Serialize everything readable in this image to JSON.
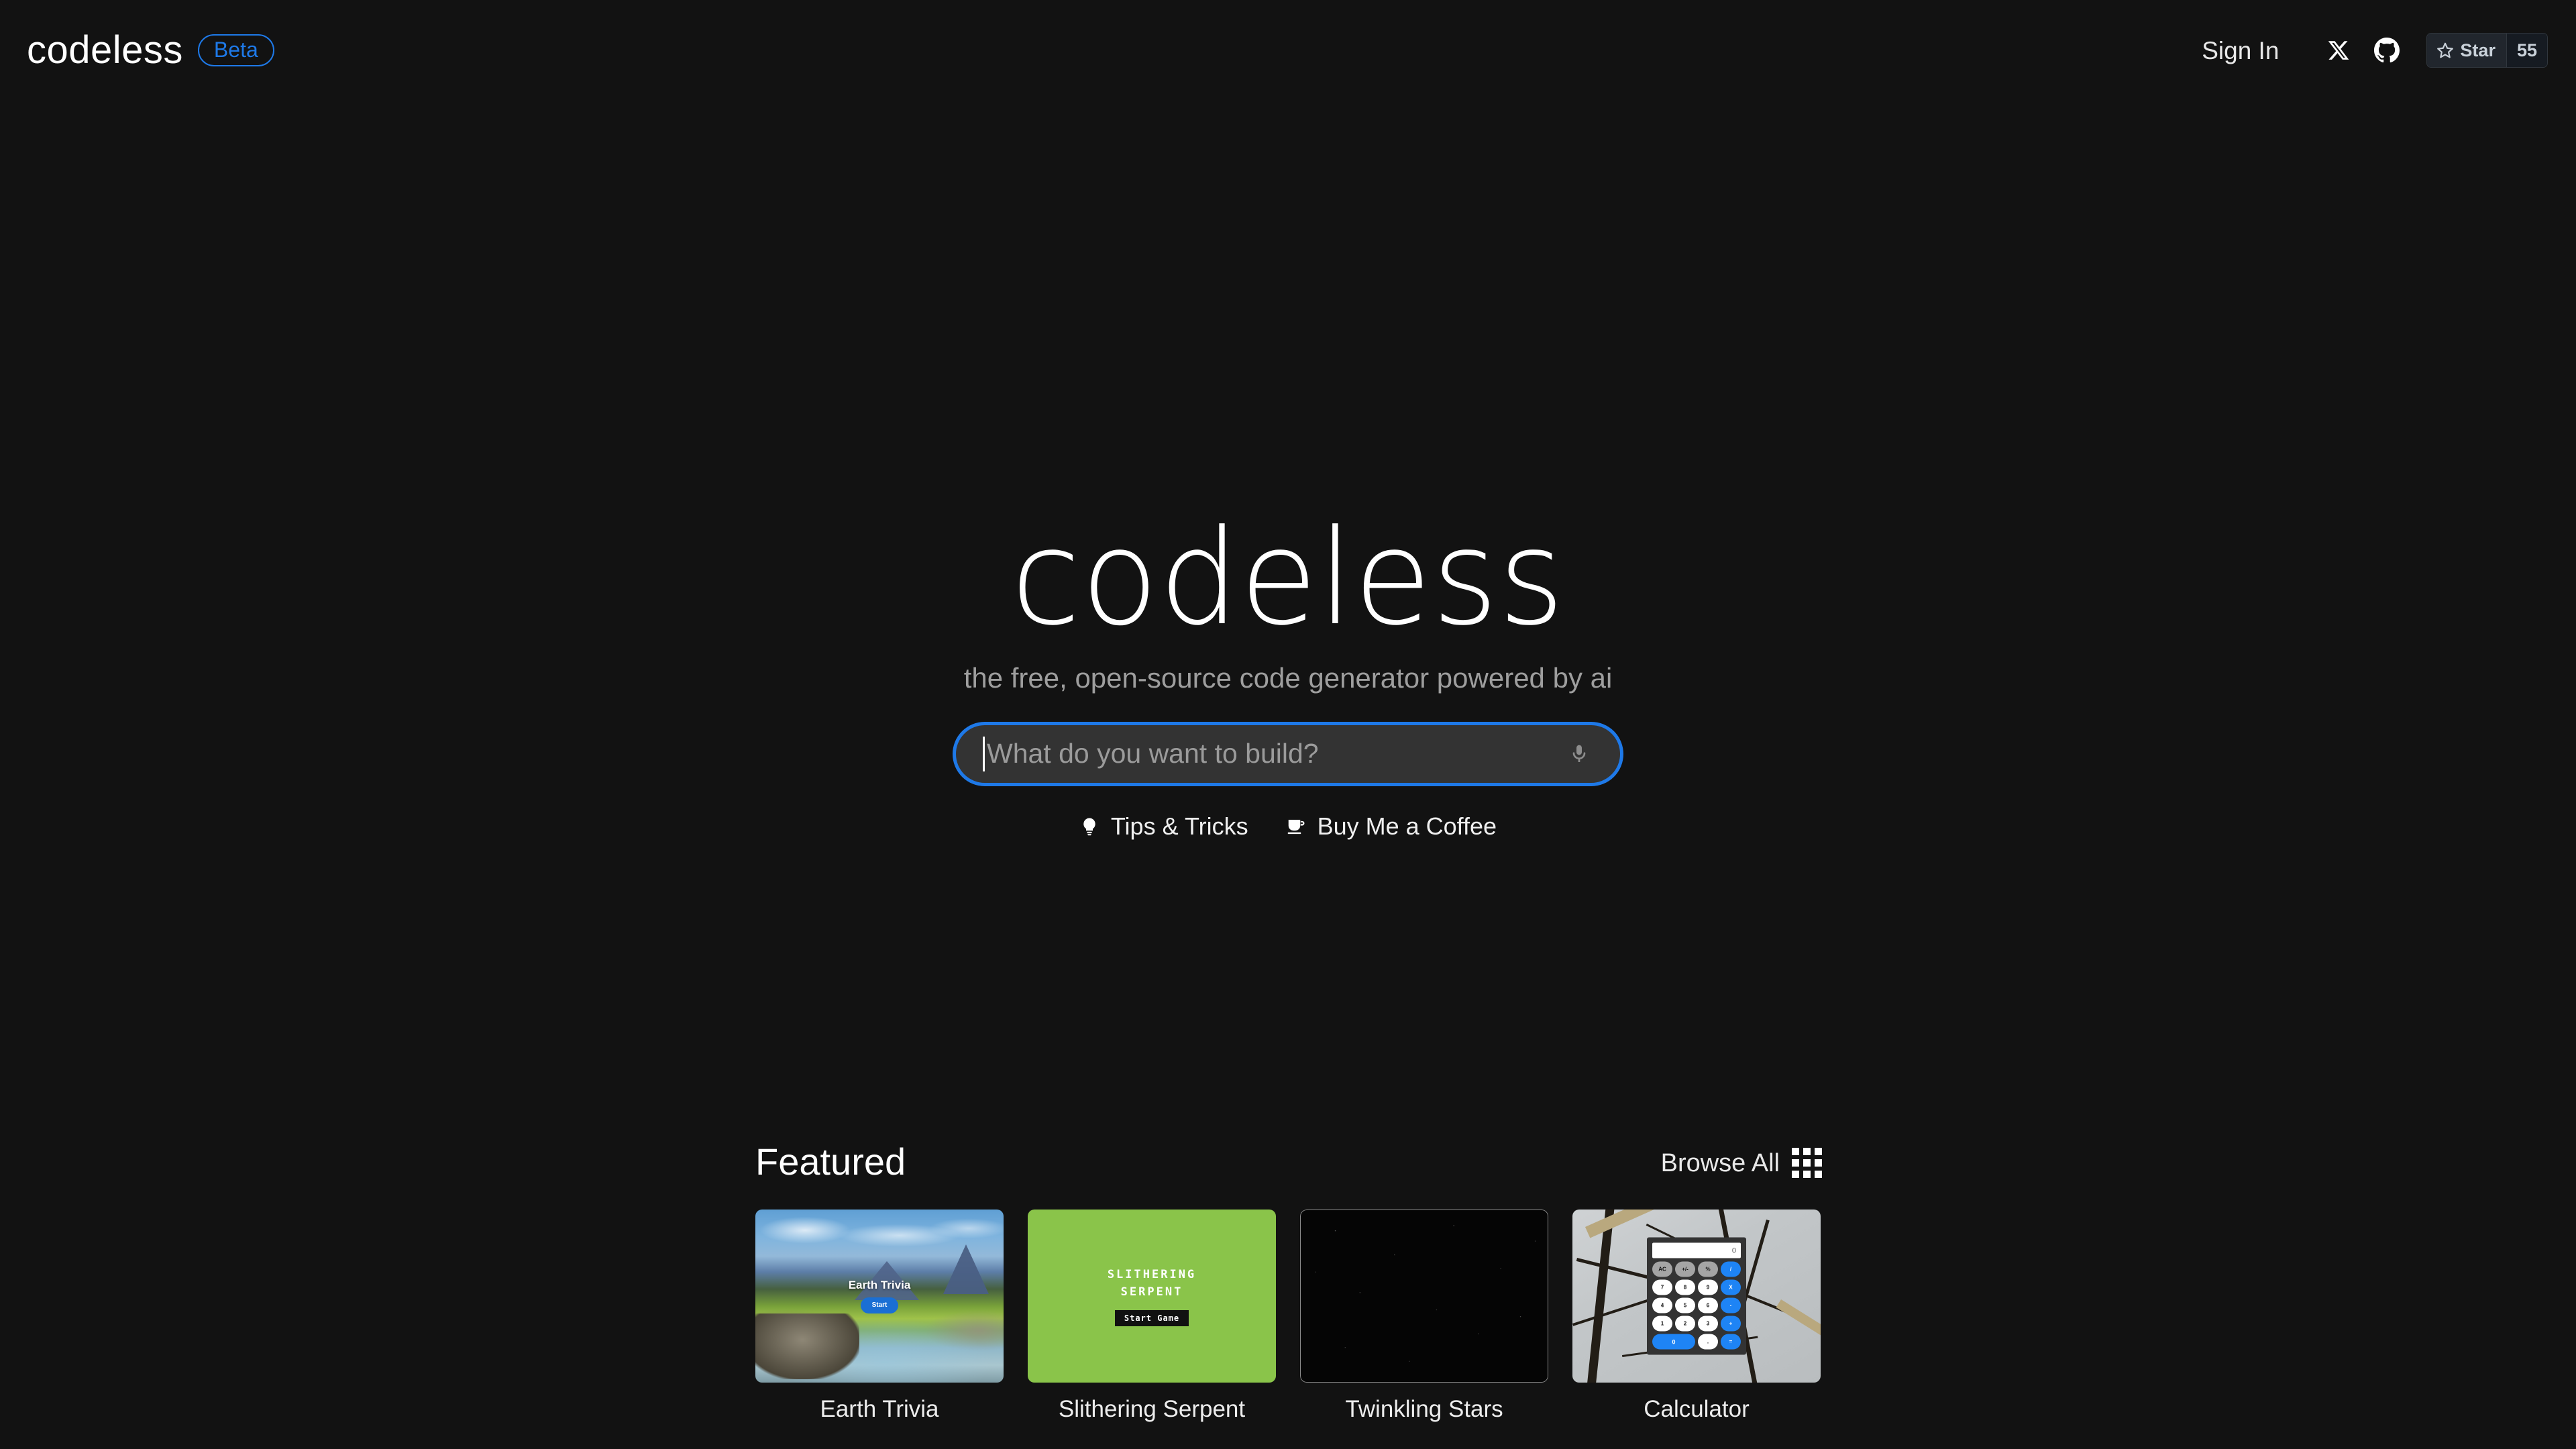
{
  "header": {
    "brand": "codeless",
    "badge": "Beta",
    "sign_in": "Sign In",
    "x_icon": "x-twitter-icon",
    "github_icon": "github-icon",
    "star_label": "Star",
    "star_count": "55",
    "accent_color": "#1e79e8"
  },
  "hero": {
    "title": "codeless",
    "tagline": "the free, open-source code generator powered by ai"
  },
  "search": {
    "placeholder": "What do you want to build?",
    "value": "",
    "mic_icon": "microphone-icon",
    "focus_color": "#1e79e8",
    "fill_color": "#333333"
  },
  "quick_links": [
    {
      "label": "Tips & Tricks",
      "icon": "lightbulb-icon"
    },
    {
      "label": "Buy Me a Coffee",
      "icon": "coffee-cup-icon"
    }
  ],
  "featured": {
    "title": "Featured",
    "browse_all": "Browse All",
    "browse_icon": "grid-icon",
    "cards": [
      {
        "label": "Earth Trivia",
        "overlay_title": "Earth Trivia",
        "button": "Start"
      },
      {
        "label": "Slithering Serpent",
        "overlay_title_line1": "SLITHERING",
        "overlay_title_line2": "SERPENT",
        "button": "Start Game",
        "bg_color": "#8ac44a"
      },
      {
        "label": "Twinkling Stars",
        "bg_color": "#050505"
      },
      {
        "label": "Calculator",
        "screen_value": "0",
        "keys": [
          "AC",
          "+/-",
          "%",
          "/",
          "7",
          "8",
          "9",
          "X",
          "4",
          "5",
          "6",
          "-",
          "1",
          "2",
          "3",
          "+",
          "0",
          ".",
          "="
        ]
      }
    ]
  }
}
